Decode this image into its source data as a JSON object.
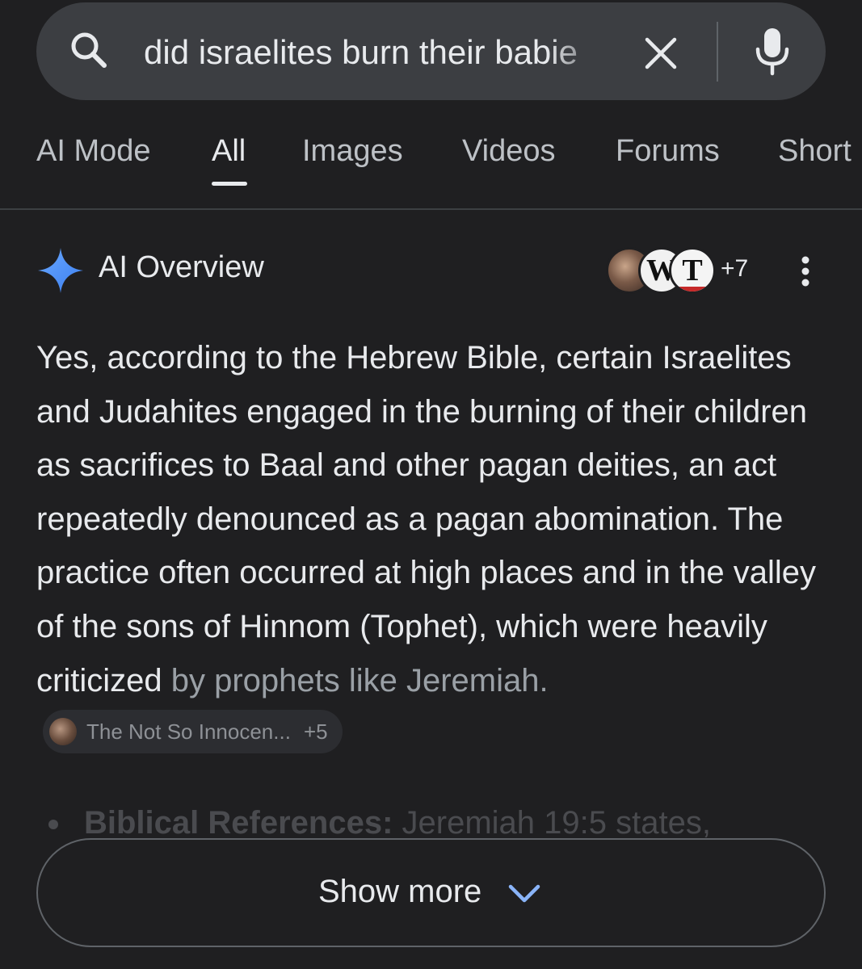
{
  "search": {
    "query": "did israelites burn their babie"
  },
  "tabs": [
    {
      "label": "AI Mode",
      "active": false
    },
    {
      "label": "All",
      "active": true
    },
    {
      "label": "Images",
      "active": false
    },
    {
      "label": "Videos",
      "active": false
    },
    {
      "label": "Forums",
      "active": false
    },
    {
      "label": "Short",
      "active": false
    }
  ],
  "ai_overview": {
    "title": "AI Overview",
    "sources": {
      "glyph_2": "W",
      "glyph_3": "T",
      "extra_count": "+7"
    },
    "body_main": "Yes, according to the Hebrew Bible, certain Israelites and Judahites engaged in the burning of their children as sacrifices to Baal and other pagan deities, an act repeatedly denounced as a pagan abomination. The practice often occurred at high places and in the valley of the sons of Hinnom (Tophet), which were heavily criticized",
    "body_faded": "by prophets like Jeremiah.",
    "citation": {
      "label": "The Not So Innocen...",
      "more": "+5"
    },
    "bullet_peek": {
      "bold": "Biblical References:",
      "text": " Jeremiah 19:5 states,"
    }
  },
  "show_more": {
    "label": "Show more"
  },
  "colors": {
    "background": "#1f1f21",
    "search_bar": "#3c3e42",
    "sparkle": "#4a90f5",
    "text": "#e8eaed",
    "muted": "#9aa0a6"
  }
}
